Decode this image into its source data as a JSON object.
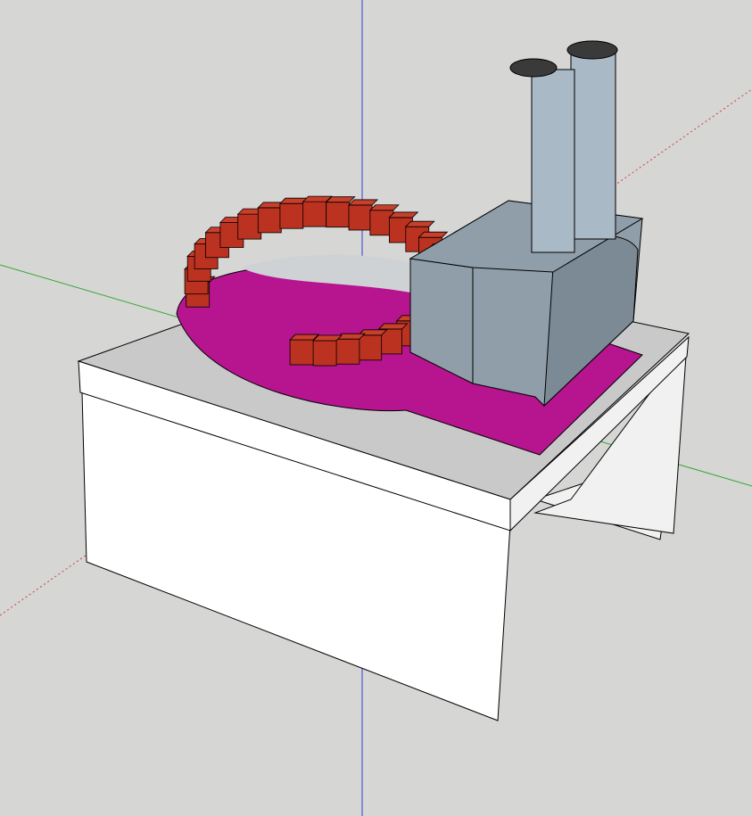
{
  "viewport": {
    "background_color": "#d6d6d4",
    "axis_colors": {
      "red": "#d23c3c",
      "green": "#35a835",
      "blue": "#3a3ae0"
    }
  },
  "model": {
    "table_colors": {
      "top": "#c9c9c9",
      "front": "#ffffff",
      "side": "#f1f1f1",
      "edge": "#000000"
    },
    "floor_color": "#b7148f",
    "brick_color": "#bb3220",
    "brick_top_color": "#c93f2b",
    "oven_color": "#8f9ea9",
    "chimney_color": "#a9b9c6",
    "cap_color": "#3a3a3a",
    "brick_count": 28
  }
}
